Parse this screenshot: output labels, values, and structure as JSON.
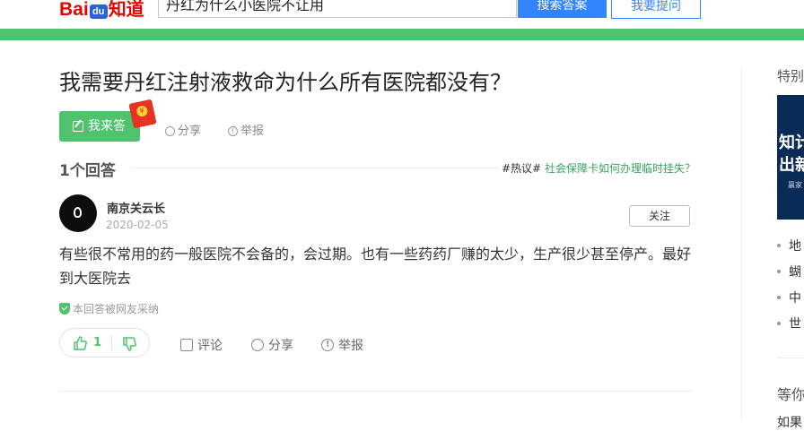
{
  "header": {
    "logo_bai": "Bai",
    "logo_paw": "du",
    "logo_zhidao": "知道",
    "search_value": "丹红为什么小医院不让用",
    "search_button": "搜索答案",
    "ask_button": "我要提问",
    "brand_color": "#e10601",
    "accent_color": "#3385ff",
    "bar_color": "#4fc26c"
  },
  "question": {
    "title": "我需要丹红注射液救命为什么所有医院都没有？",
    "answer_button": "我来答",
    "share": "分享",
    "report": "举报"
  },
  "answers_header": {
    "count": "1个回答",
    "hot_tag": "#热议#",
    "hot_link": "社会保障卡如何办理临时挂失？"
  },
  "answer": {
    "author": "南京关云长",
    "date": "2020-02-05",
    "follow": "关注",
    "text": "有些很不常用的药一般医院不会备的，会过期。也有一些药药厂赚的太少，生产很少甚至停产。最好到大医院去",
    "adopted": "本回答被网友采纳",
    "likes": "1",
    "comment": "评论",
    "share": "分享",
    "report": "举报"
  },
  "sidebar": {
    "title": "特别",
    "banner_line1": "知计",
    "banner_line2": "出新",
    "banner_small": "赢家 赢取",
    "items": [
      "地",
      "蝴",
      "中",
      "世"
    ],
    "wait_title": "等你",
    "cut_text": "如果"
  }
}
